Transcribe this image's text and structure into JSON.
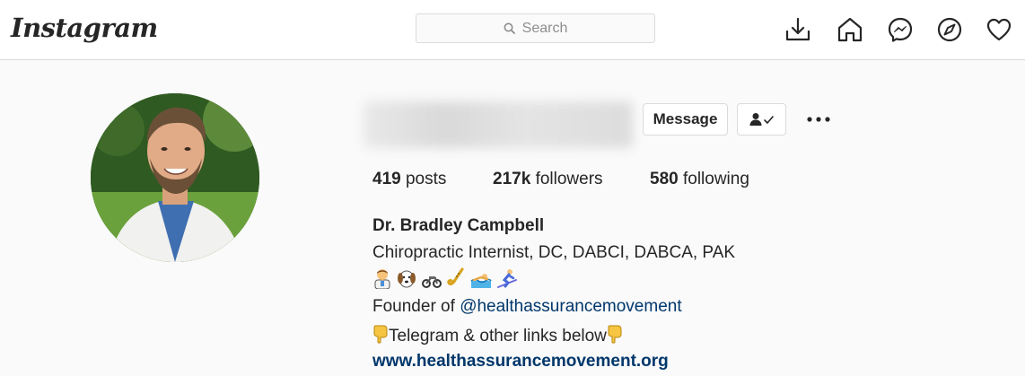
{
  "header": {
    "logo": "Instagram",
    "search_placeholder": "Search",
    "icons": [
      "download-icon",
      "home-icon",
      "messenger-icon",
      "explore-icon",
      "heart-icon"
    ]
  },
  "profile": {
    "buttons": {
      "message": "Message"
    },
    "stats": {
      "posts_value": "419",
      "posts_label": "posts",
      "followers_value": "217k",
      "followers_label": "followers",
      "following_value": "580",
      "following_label": "following"
    },
    "bio": {
      "name": "Dr. Bradley Campbell",
      "title": "Chiropractic Internist, DC, DABCI, DABCA, PAK",
      "emojis": [
        "doctor-emoji",
        "dog-emoji",
        "motorcycle-emoji",
        "saxophone-emoji",
        "swimmer-emoji",
        "skier-emoji"
      ],
      "founder_prefix": "Founder of",
      "founder_mention": "@healthassurancemovement",
      "telegram_text": "Telegram & other links below",
      "website": "www.healthassurancemovement.org"
    }
  },
  "colors": {
    "link": "#00376b",
    "border": "#dbdbdb",
    "background": "#fafafa"
  }
}
